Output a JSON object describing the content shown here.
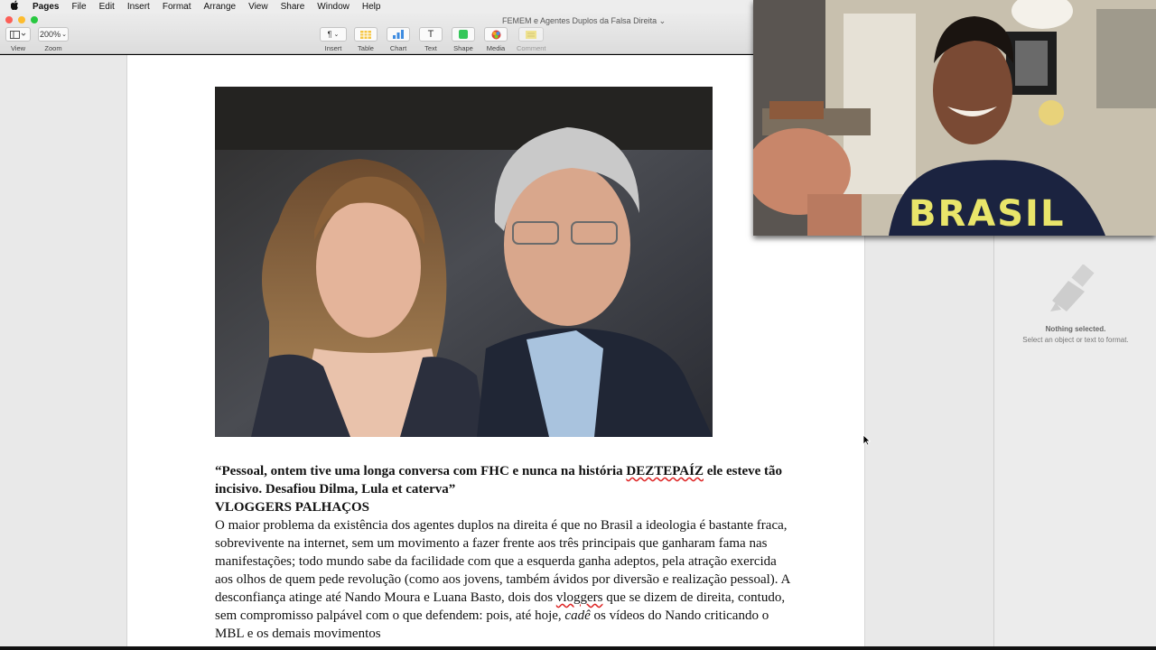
{
  "menubar": {
    "apple": "",
    "items": [
      "Pages",
      "File",
      "Edit",
      "Insert",
      "Format",
      "Arrange",
      "View",
      "Share",
      "Window",
      "Help"
    ]
  },
  "window": {
    "title": "FEMEM e Agentes Duplos da Falsa Direita",
    "title_chevron": "⌄"
  },
  "toolbar": {
    "view_label": "View",
    "zoom_label": "Zoom",
    "zoom_value": "200%",
    "buttons": [
      {
        "label": "Insert",
        "glyph": "¶"
      },
      {
        "label": "Table",
        "glyph": ""
      },
      {
        "label": "Chart",
        "glyph": ""
      },
      {
        "label": "Text",
        "glyph": "T"
      },
      {
        "label": "Shape",
        "glyph": ""
      },
      {
        "label": "Media",
        "glyph": ""
      },
      {
        "label": "Comment",
        "glyph": ""
      }
    ]
  },
  "document": {
    "quote_line1_a": "“Pessoal, ontem tive uma longa conversa com FHC e nunca na história ",
    "quote_misspelled": "DEZTEPAÍZ",
    "quote_line1_b": " ele esteve tão incisivo. Desafiou Dilma, Lula et caterva”",
    "heading": "VLOGGERS PALHAÇOS",
    "para_a": "O maior problema da existência dos agentes duplos na direita é que no Brasil a ideologia é bastante fraca, sobrevivente na internet, sem um movimento a fazer frente aos três principais que ganharam fama nas manifestações; todo mundo sabe da facilidade com que a esquerda ganha adeptos, pela atração exercida aos olhos de quem pede revolução (como aos jovens, também ávidos por diversão e realização pessoal).  A desconfiança atinge até Nando Moura e Luana Basto, dois dos ",
    "para_misspelled": "vloggers",
    "para_b": " que se dizem de direita, contudo, sem compromisso palpável com o que defendem: pois, até hoje, ",
    "para_italic": "cadê",
    "para_c": " os vídeos do Nando criticando o MBL e os demais movimentos"
  },
  "inspector": {
    "nothing_selected": "Nothing selected.",
    "hint": "Select an object or text to format."
  },
  "webcam": {
    "shirt_text": "BRASIL"
  },
  "colors": {
    "accent_red": "#fc5f57",
    "accent_yellow": "#fdbc2e",
    "accent_green": "#28c840",
    "spell_underline": "#dd2222"
  },
  "icons": [
    "apple-icon",
    "sidebar-view-icon",
    "paragraph-icon",
    "table-icon",
    "chart-icon",
    "text-icon",
    "shape-icon",
    "media-icon",
    "comment-icon",
    "paintbrush-icon",
    "cursor-icon"
  ]
}
